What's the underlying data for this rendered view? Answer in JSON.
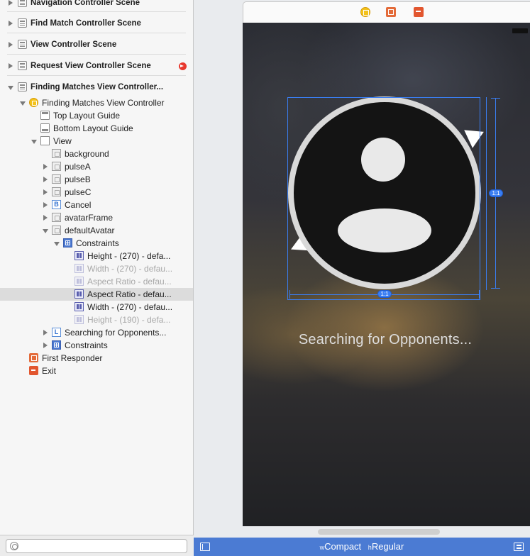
{
  "outline": {
    "scenes": [
      {
        "label": "Navigation Controller Scene"
      },
      {
        "label": "Find Match Controller Scene"
      },
      {
        "label": "View Controller Scene"
      },
      {
        "label": "Request View Controller Scene"
      },
      {
        "label": "Finding Matches View Controller..."
      }
    ],
    "tree": {
      "vc": "Finding Matches View Controller",
      "top_guide": "Top Layout Guide",
      "bottom_guide": "Bottom Layout Guide",
      "view": "View",
      "background": "background",
      "pulse_a": "pulseA",
      "pulse_b": "pulseB",
      "pulse_c": "pulseC",
      "cancel": "Cancel",
      "cancel_icon_letter": "B",
      "avatar_frame": "avatarFrame",
      "default_avatar": "defaultAvatar",
      "constraints": "Constraints",
      "constraint_items": [
        "Height - (270) - defa...",
        "Width - (270) - defau...",
        "Aspect Ratio - defau...",
        "Aspect Ratio - defau...",
        "Width - (270) - defau...",
        "Height - (190) - defa..."
      ],
      "searching_label": "Searching for Opponents...",
      "searching_icon_letter": "L",
      "constraints_2": "Constraints",
      "first_responder": "First Responder",
      "exit": "Exit"
    }
  },
  "canvas": {
    "searching_text": "Searching for Opponents...",
    "ratio_badge_vertical": "1:1",
    "ratio_badge_horizontal": "1:1"
  },
  "size_bar": {
    "w_prefix": "w",
    "width_class": "Compact",
    "h_prefix": "h",
    "height_class": "Regular"
  },
  "colors": {
    "accent": "#3a7ef2",
    "size_bar": "#4b7bd3",
    "error": "#e8382e"
  }
}
